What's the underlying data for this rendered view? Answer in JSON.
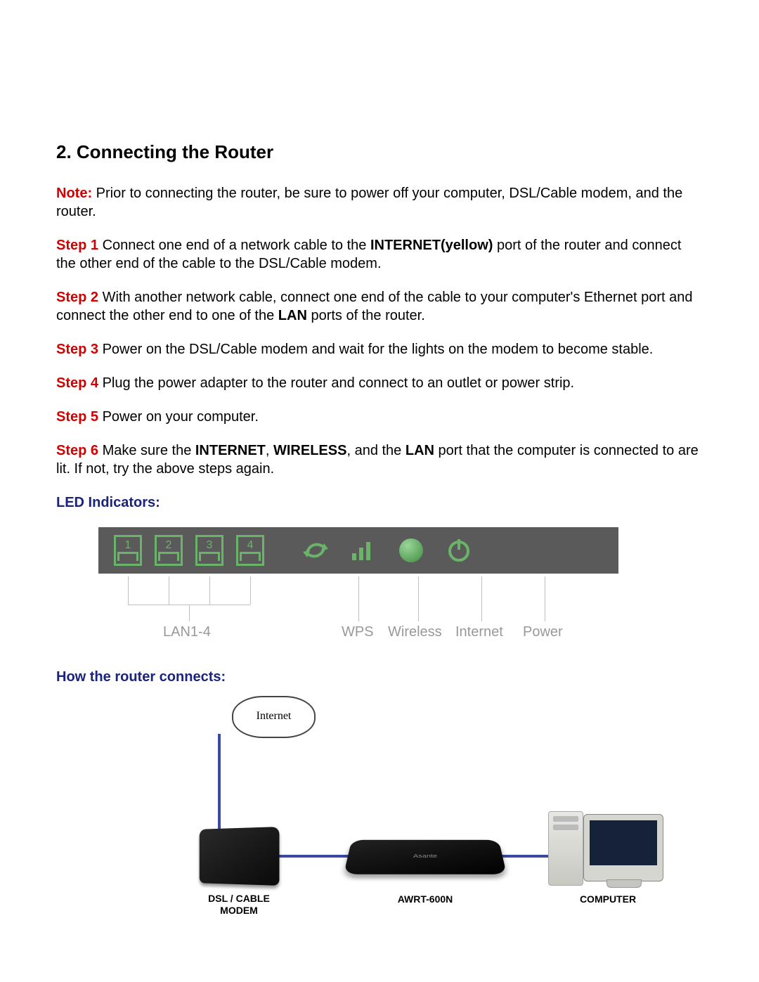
{
  "heading": "2. Connecting the Router",
  "note_label": "Note:",
  "note_text": " Prior to connecting the router, be sure to power off your computer, DSL/Cable modem, and the router.",
  "steps": [
    {
      "label": "Step 1",
      "pre": " Connect one end of a network cable to the ",
      "bold": "INTERNET(yellow)",
      "post": " port of the router and connect the other end of the cable to the DSL/Cable modem."
    },
    {
      "label": "Step 2",
      "pre": " With another network cable, connect one end of the cable to your computer's Ethernet port and connect the other end to one of the ",
      "bold": "LAN",
      "post": " ports of the router."
    },
    {
      "label": "Step 3",
      "pre": " Power on the DSL/Cable modem and wait for the lights on the modem to become stable.",
      "bold": "",
      "post": ""
    },
    {
      "label": "Step 4",
      "pre": " Plug the power adapter to the router and connect to an outlet or power strip.",
      "bold": "",
      "post": ""
    },
    {
      "label": "Step 5",
      "pre": " Power on your computer.",
      "bold": "",
      "post": ""
    }
  ],
  "step6": {
    "label": "Step 6",
    "pre": " Make sure the ",
    "b1": "INTERNET",
    "sep1": ", ",
    "b2": "WIRELESS",
    "sep2": ", and the ",
    "b3": "LAN",
    "post": " port that the computer is connected to are lit. If not, try the above steps again."
  },
  "led_heading": "LED Indicators:",
  "led_panel": {
    "lan_nums": [
      "1",
      "2",
      "3",
      "4"
    ],
    "legend": {
      "lan": "LAN1-4",
      "wps": "WPS",
      "wireless": "Wireless",
      "internet": "Internet",
      "power": "Power"
    }
  },
  "connect_heading": "How the router connects:",
  "diagram": {
    "cloud": "Internet",
    "modem": "DSL / CABLE MODEM",
    "router": "AWRT-600N",
    "router_brand": "Asante",
    "computer": "COMPUTER"
  }
}
